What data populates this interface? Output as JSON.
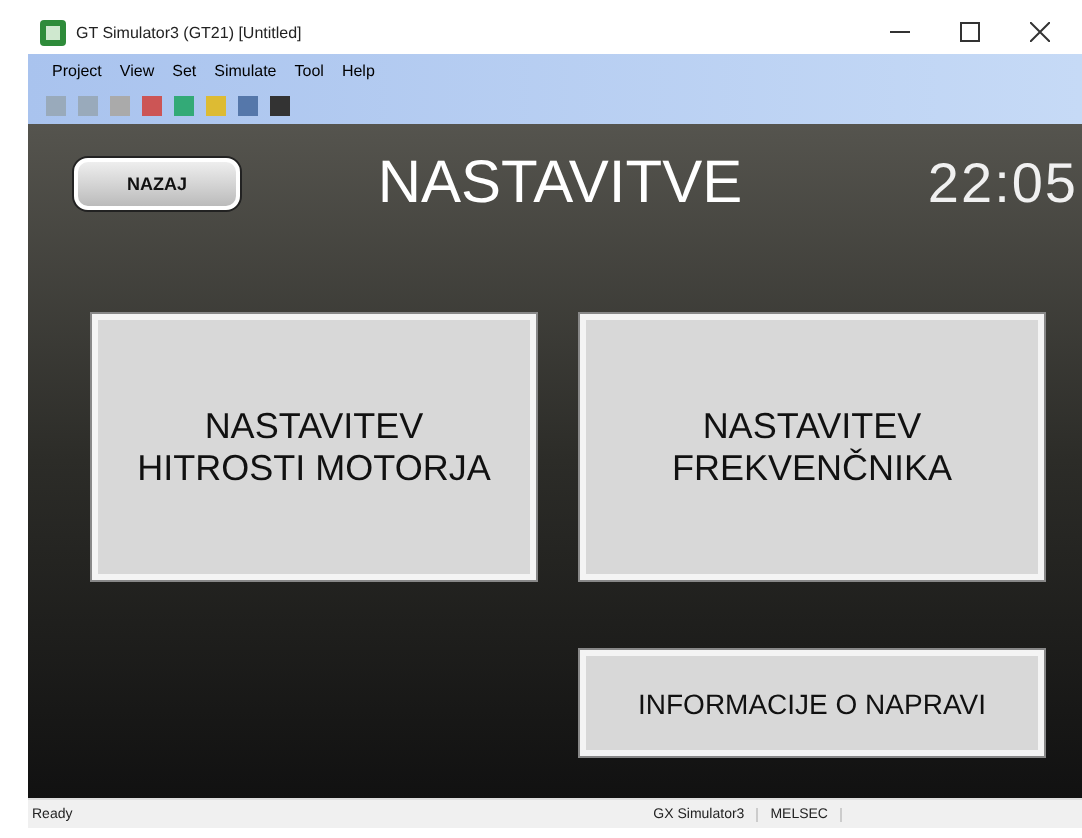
{
  "window": {
    "title": "GT Simulator3 (GT21)  [Untitled]"
  },
  "menu": [
    "Project",
    "View",
    "Set",
    "Simulate",
    "Tool",
    "Help"
  ],
  "screen": {
    "back_button": "NAZAJ",
    "title": "NASTAVITVE",
    "clock": "22:05",
    "buttons": [
      {
        "label": "NASTAVITEV HITROSTI MOTORJA"
      },
      {
        "label": "NASTAVITEV FREKVENČNIKA"
      },
      {
        "label": "INFORMACIJE O NAPRAVI"
      }
    ]
  },
  "status_bar": {
    "left": "Ready",
    "panels": [
      "GX Simulator3",
      "MELSEC"
    ]
  }
}
